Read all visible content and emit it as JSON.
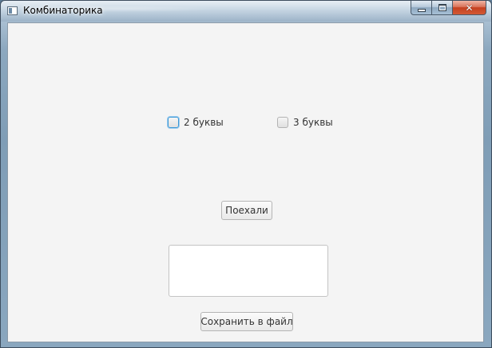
{
  "window": {
    "title": "Комбинаторика",
    "close_glyph": "✕"
  },
  "options": {
    "two_letters": {
      "label": "2 буквы",
      "checked": false
    },
    "three_letters": {
      "label": "3 буквы",
      "checked": false
    }
  },
  "actions": {
    "go_label": "Поехали",
    "save_label": "Сохранить в файл"
  },
  "output": {
    "value": ""
  }
}
